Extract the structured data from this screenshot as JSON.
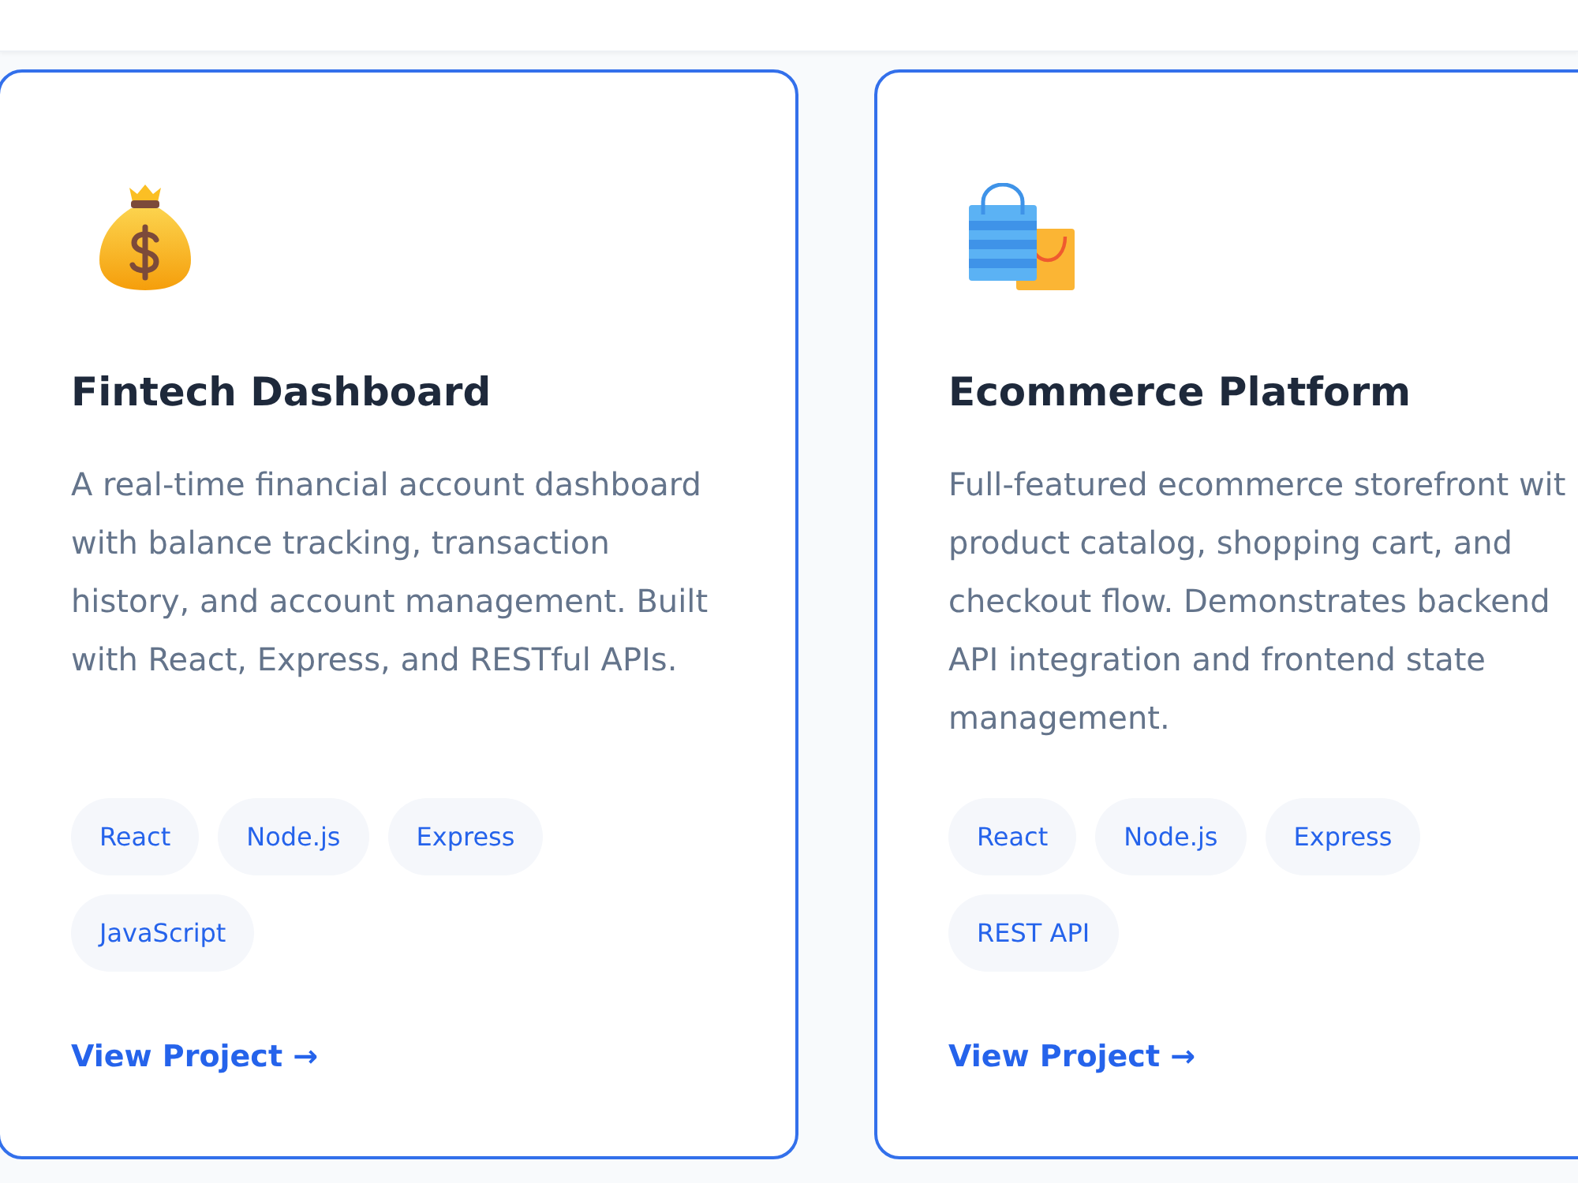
{
  "projects": [
    {
      "title": "Fintech Dashboard",
      "description_lines": [
        "A real-time financial account dashboard",
        "with balance tracking, transaction",
        "history, and account management. Built",
        "with React, Express, and RESTful APIs."
      ],
      "tags": [
        "React",
        "Node.js",
        "Express",
        "JavaScript"
      ],
      "link": "View Project →"
    },
    {
      "title": "Ecommerce Platform",
      "description_lines": [
        "Full-featured ecommerce storefront wit",
        "product catalog, shopping cart, and",
        "checkout flow. Demonstrates backend",
        "API integration and frontend state",
        "management."
      ],
      "tags": [
        "React",
        "Node.js",
        "Express",
        "REST API"
      ],
      "link": "View Project →"
    }
  ]
}
